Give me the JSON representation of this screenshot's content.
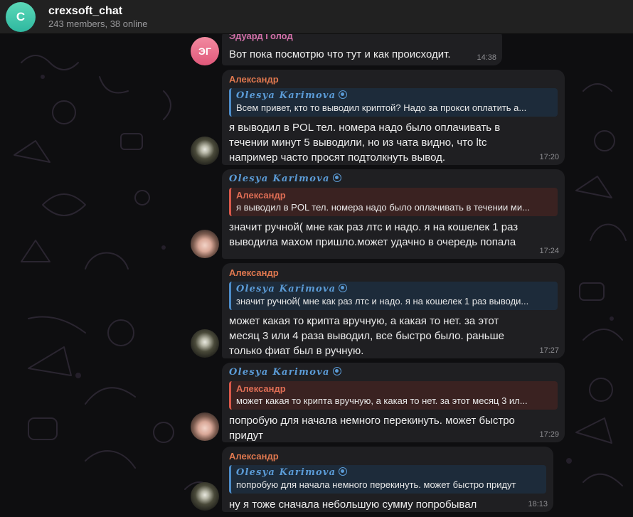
{
  "header": {
    "avatar_letter": "C",
    "title": "crexsoft_chat",
    "subtitle": "243 members, 38 online"
  },
  "messages": [
    {
      "sender": "Эдуард Голод",
      "avatar_text": "ЭГ",
      "text": "Вот пока посмотрю что тут и как происходит.",
      "time": "14:38"
    },
    {
      "sender": "Александр",
      "reply_name": "Olesya Karimova",
      "reply_text": "Всем привет, кто то выводил криптой? Надо за прокси оплатить а...",
      "text_lines": [
        "я выводил в POL тел. номера надо было оплачивать в",
        "течении минут 5 выводили, но из чата видно, что ltc",
        "например часто просят подтолкнуть вывод."
      ],
      "time": "17:20"
    },
    {
      "sender": "Olesya Karimova",
      "reply_name": "Александр",
      "reply_text": "я выводил в POL тел. номера надо было оплачивать в течении ми...",
      "text_lines": [
        "значит ручной( мне как раз лтс и надо. я на кошелек 1 раз",
        "выводила махом пришло.может удачно в очередь попала"
      ],
      "time": "17:24"
    },
    {
      "sender": "Александр",
      "reply_name": "Olesya Karimova",
      "reply_text": "значит ручной( мне как раз лтс и надо. я на кошелек 1 раз выводи...",
      "text_lines": [
        "может какая то крипта вручную, а какая то нет. за этот",
        "месяц 3 или 4 раза выводил, все быстро было. раньше",
        "только фиат был в ручную."
      ],
      "time": "17:27"
    },
    {
      "sender": "Olesya Karimova",
      "reply_name": "Александр",
      "reply_text": "может какая то крипта вручную, а какая то нет. за этот месяц 3 ил...",
      "text_lines": [
        "попробую для начала немного перекинуть. может быстро",
        "придут"
      ],
      "time": "17:29"
    },
    {
      "sender": "Александр",
      "reply_name": "Olesya Karimova",
      "reply_text": "попробую для начала немного перекинуть. может быстро придут",
      "text_lines": [
        "ну я тоже сначала небольшую сумму попробывал"
      ],
      "time": "18:13"
    }
  ],
  "colors": {
    "background": "#0e0e10",
    "bubble": "#1f1f22",
    "header": "#212121",
    "sender_orange": "#e0784f",
    "sender_pink": "#d16fa8",
    "sender_blue": "#5b9bd6"
  }
}
